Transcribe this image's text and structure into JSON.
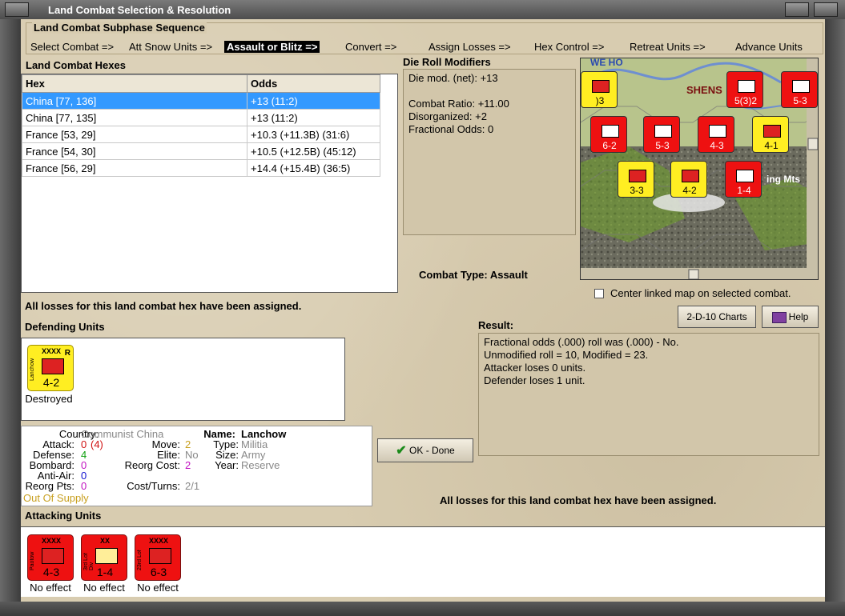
{
  "window": {
    "title": "Land Combat Selection & Resolution"
  },
  "subphase": {
    "title": "Land Combat Subphase Sequence",
    "steps": [
      "Select Combat =>",
      "Att Snow Units =>",
      "Assault or Blitz =>",
      "Convert =>",
      "Assign Losses =>",
      "Hex Control =>",
      "Retreat Units =>",
      "Advance Units"
    ]
  },
  "hexes": {
    "title": "Land Combat Hexes",
    "columns": [
      "Hex",
      "Odds"
    ],
    "rows": [
      {
        "hex": "China [77, 136]",
        "odds": "+13 (11:2)"
      },
      {
        "hex": "China [77, 135]",
        "odds": "+13 (11:2)"
      },
      {
        "hex": "France [53, 29]",
        "odds": "+10.3 (+11.3B) (31:6)"
      },
      {
        "hex": "France [54, 30]",
        "odds": "+10.5 (+12.5B) (45:12)"
      },
      {
        "hex": "France [56, 29]",
        "odds": "+14.4 (+15.4B) (36:5)"
      }
    ]
  },
  "die_roll": {
    "title": "Die Roll Modifiers",
    "net": "Die mod. (net): +13",
    "ratio": "Combat Ratio: +11.00",
    "disorganized": "Disorganized: +2",
    "fractional": "Fractional Odds: 0"
  },
  "combat_type": "Combat Type:  Assault",
  "center_map_label": "Center linked map on selected combat.",
  "losses_assigned": "All losses for this land combat hex have been assigned.",
  "buttons": {
    "charts": "2-D-10 Charts",
    "help": "Help",
    "ok": "OK - Done"
  },
  "result": {
    "title": "Result:",
    "lines": [
      "Fractional odds (.000) roll was (.000)  - No.",
      "Unmodified roll = 10, Modified = 23.",
      "Attacker loses 0 units.",
      "Defender loses 1 unit."
    ]
  },
  "defending": {
    "title": "Defending Units",
    "units": [
      {
        "name": "Lanchow",
        "size": "XXXX",
        "strength": "4-2",
        "badge": "R",
        "status": "Destroyed"
      }
    ]
  },
  "unit_info": {
    "country_label": "Country:",
    "country": "Communist China",
    "attack_label": "Attack:",
    "attack": "0",
    "attack_mod": "(4)",
    "defense_label": "Defense:",
    "defense": "4",
    "bombard_label": "Bombard:",
    "bombard": "0",
    "antiair_label": "Anti-Air:",
    "antiair": "0",
    "reorg_pts_label": "Reorg Pts:",
    "reorg_pts": "0",
    "supply": "Out Of Supply",
    "move_label": "Move:",
    "move": "2",
    "elite_label": "Elite:",
    "elite": "No",
    "reorg_cost_label": "Reorg Cost:",
    "reorg_cost": "2",
    "cost_turns_label": "Cost/Turns:",
    "cost_turns": "2/1",
    "name_label": "Name:",
    "name": "Lanchow",
    "type_label": "Type:",
    "type": "Militia",
    "size_label": "Size:",
    "size": "Army",
    "year_label": "Year:",
    "year": "Reserve"
  },
  "attacking": {
    "title": "Attacking Units",
    "units": [
      {
        "name": "Paotow",
        "size": "XXXX",
        "strength": "4-3",
        "status": "No effect"
      },
      {
        "name": "3rd Lof Div",
        "size": "XX",
        "strength": "1-4",
        "status": "No effect"
      },
      {
        "name": "23rd Lof",
        "size": "XXXX",
        "strength": "6-3",
        "status": "No effect"
      }
    ]
  },
  "map": {
    "labels": {
      "region": "SHENS",
      "mountains": "ing Mts",
      "river": "WE HO"
    },
    "counters": [
      {
        "strength": "5(3)2",
        "color": "#ee1111"
      },
      {
        "strength": "5-3",
        "color": "#ee1111"
      },
      {
        "strength": "6-2",
        "color": "#ee1111"
      },
      {
        "strength": "5-3",
        "color": "#ee1111"
      },
      {
        "strength": "4-3",
        "color": "#ee1111"
      },
      {
        "strength": "4-1",
        "color": "#ffee22"
      },
      {
        "strength": "3-3",
        "color": "#ffee22"
      },
      {
        "strength": "4-2",
        "color": "#ffee22"
      },
      {
        "strength": "1-4",
        "color": "#ee1111"
      },
      {
        "strength": ")3",
        "color": "#ffee22"
      }
    ]
  },
  "colors": {
    "selected_row": "#3399ff",
    "red_counter": "#ee1111",
    "yellow_counter": "#ffee22",
    "supply": "#c8a020"
  }
}
